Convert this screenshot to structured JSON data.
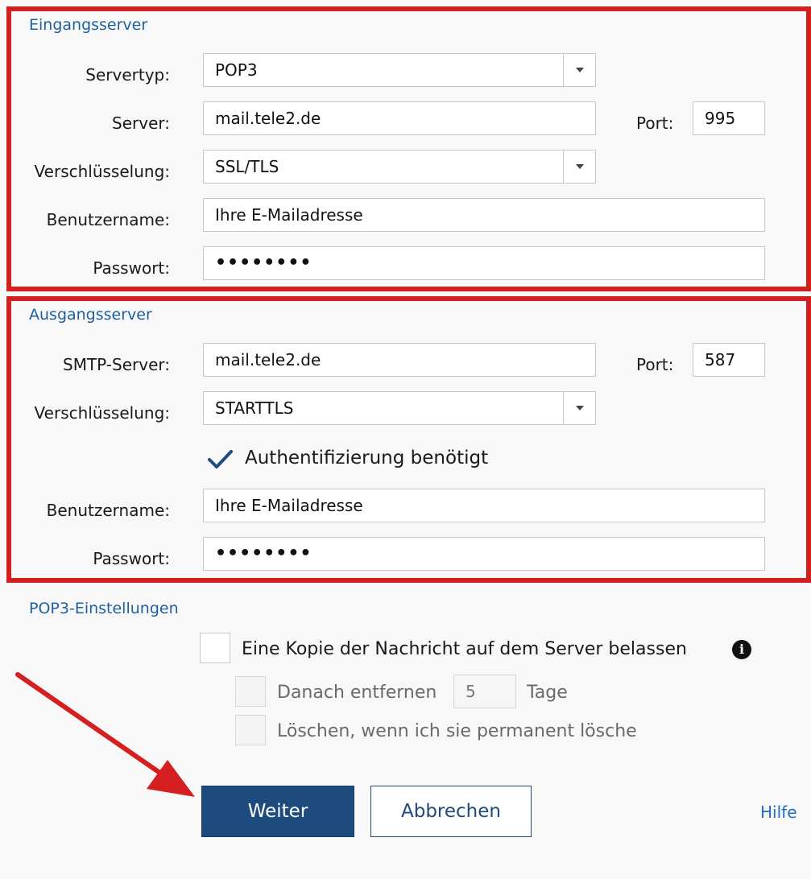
{
  "incoming": {
    "title": "Eingangsserver",
    "servertype_label": "Servertyp:",
    "servertype_value": "POP3",
    "server_label": "Server:",
    "server_value": "mail.tele2.de",
    "port_label": "Port:",
    "port_value": "995",
    "encryption_label": "Verschlüsselung:",
    "encryption_value": "SSL/TLS",
    "username_label": "Benutzername:",
    "username_value": "Ihre E-Mailadresse",
    "password_label": "Passwort:",
    "password_mask": "••••••••"
  },
  "outgoing": {
    "title": "Ausgangsserver",
    "smtp_label": "SMTP-Server:",
    "smtp_value": "mail.tele2.de",
    "port_label": "Port:",
    "port_value": "587",
    "encryption_label": "Verschlüsselung:",
    "encryption_value": "STARTTLS",
    "auth_label": "Authentifizierung benötigt",
    "auth_checked": true,
    "username_label": "Benutzername:",
    "username_value": "Ihre E-Mailadresse",
    "password_label": "Passwort:",
    "password_mask": "••••••••"
  },
  "pop3": {
    "title": "POP3-Einstellungen",
    "keep_copy_label": "Eine Kopie der Nachricht auf dem Server belassen",
    "remove_after_label": "Danach entfernen",
    "days_value": "5",
    "days_unit": "Tage",
    "delete_label": "Löschen, wenn ich sie permanent lösche"
  },
  "buttons": {
    "next": "Weiter",
    "cancel": "Abbrechen",
    "help": "Hilfe"
  },
  "colors": {
    "highlight": "#d21f1f",
    "primary": "#1e4b7d",
    "section_title": "#1f5f9f"
  },
  "icons": {
    "info": "info-icon",
    "dropdown": "chevron-down-icon",
    "check": "checkmark-icon",
    "annotation": "red-arrow"
  }
}
